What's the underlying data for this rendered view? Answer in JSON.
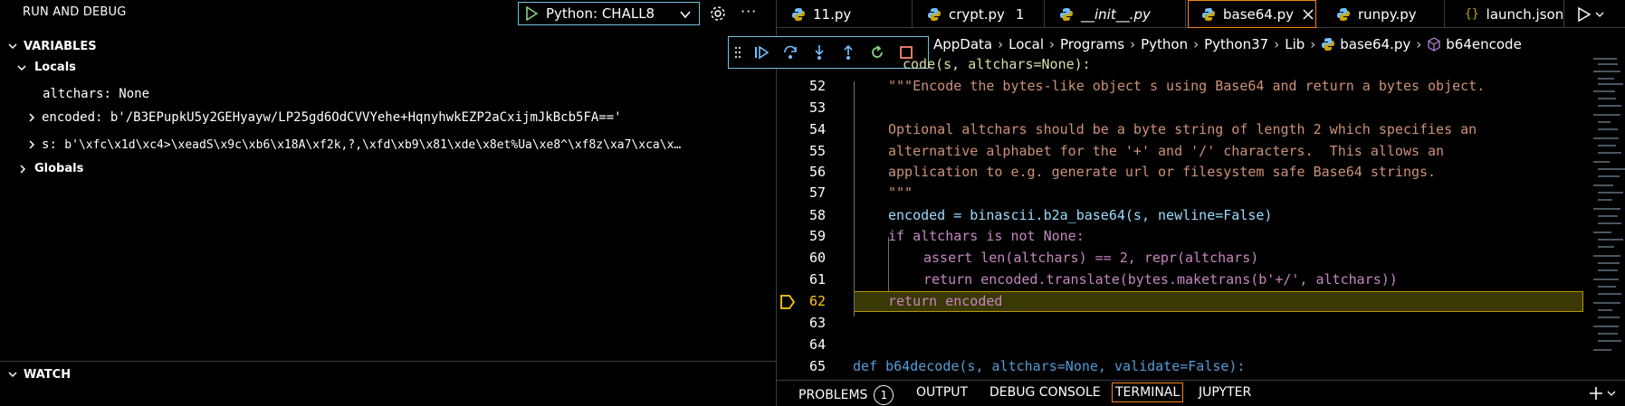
{
  "debug_panel": {
    "title": "RUN AND DEBUG",
    "config_label": "Python: CHALL8",
    "more_label": "···"
  },
  "variables": {
    "header": "VARIABLES",
    "locals_label": "Locals",
    "items": [
      {
        "name": "altchars",
        "value": "None"
      },
      {
        "name": "encoded",
        "value": "b'/B3EPupkU5y2GEHyayw/LP25gd6OdCVVYehe+HqnyhwkEZP2aCxijmJkBcb5FA=='"
      },
      {
        "name": "s",
        "value": "b'\\xfc\\x1d\\xc4>\\xeadS\\x9c\\xb6\\x18A\\xf2k,?,\\xfd\\xb9\\x81\\xde\\x8et%Ua\\xe8^\\xf8z\\xa7\\xca\\x…"
      }
    ],
    "globals_label": "Globals"
  },
  "watch": {
    "header": "WATCH"
  },
  "tabs": [
    {
      "label": "11.py",
      "badge": "",
      "italic": false
    },
    {
      "label": "crypt.py",
      "badge": "1",
      "italic": false
    },
    {
      "label": "__init__.py",
      "badge": "",
      "italic": true
    },
    {
      "label": "base64.py",
      "badge": "",
      "italic": false,
      "active": true
    },
    {
      "label": "runpy.py",
      "badge": "",
      "italic": false
    },
    {
      "label": "launch.json",
      "badge": "",
      "italic": false
    }
  ],
  "breadcrumb": [
    "AppData",
    "Local",
    "Programs",
    "Python",
    "Python37",
    "Lib",
    "base64.py",
    "b64encode"
  ],
  "code": {
    "line_numbers": [
      "52",
      "53",
      "54",
      "55",
      "56",
      "57",
      "58",
      "59",
      "60",
      "61",
      "62",
      "63",
      "64",
      "65"
    ],
    "current_line": "62",
    "line51_partial": "code(s, altchars=None):",
    "line52": "\"\"\"Encode the bytes-like object s using Base64 and return a bytes object.",
    "line54": "Optional altchars should be a byte string of length 2 which specifies an",
    "line55": "alternative alphabet for the '+' and '/' characters.  This allows an",
    "line56": "application to e.g. generate url or filesystem safe Base64 strings.",
    "line57": "\"\"\"",
    "line58": "encoded = binascii.b2a_base64(s, newline=False)",
    "line59": "if altchars is not None:",
    "line60": "assert len(altchars) == 2, repr(altchars)",
    "line61": "return encoded.translate(bytes.maketrans(b'+/', altchars))",
    "line62": "return encoded",
    "line65": "def b64decode(s, altchars=None, validate=False):"
  },
  "panel_tabs": {
    "problems": "PROBLEMS",
    "problems_count": "1",
    "output": "OUTPUT",
    "debug_console": "DEBUG CONSOLE",
    "terminal": "TERMINAL",
    "jupyter": "JUPYTER"
  },
  "colors": {
    "accent": "#f38518",
    "focus": "#6fc3df",
    "keyword": "#569cd6",
    "string": "#ce9178",
    "function": "#dcdcaa",
    "variable": "#9cdcfe",
    "debug_green": "#89d185",
    "debug_blue": "#75beff"
  }
}
